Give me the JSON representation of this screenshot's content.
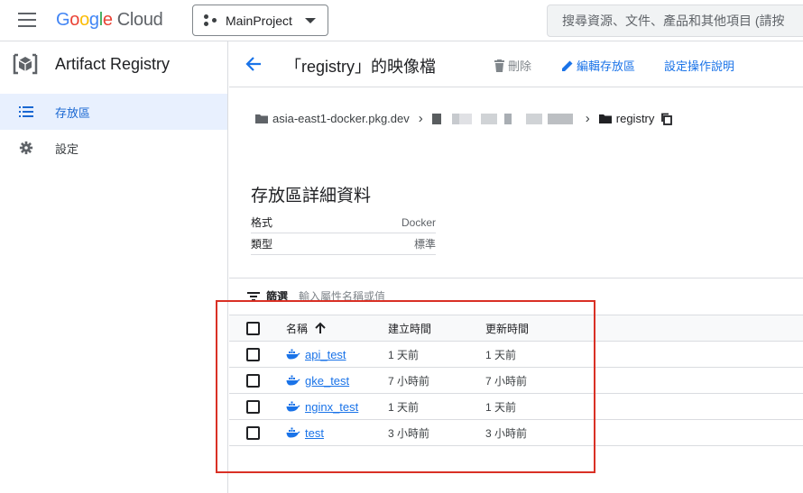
{
  "topbar": {
    "logo_letters": [
      "G",
      "o",
      "o",
      "g",
      "l",
      "e"
    ],
    "logo_cloud": "Cloud",
    "project_name": "MainProject",
    "search_placeholder": "搜尋資源、文件、產品和其他項目 (請按"
  },
  "sidebar": {
    "product_title": "Artifact Registry",
    "items": [
      {
        "label": "存放區",
        "icon": "list-icon",
        "active": true
      },
      {
        "label": "設定",
        "icon": "gear-icon",
        "active": false
      }
    ]
  },
  "header": {
    "title": "「registry」的映像檔",
    "delete_label": "刪除",
    "edit_label": "編輯存放區",
    "help_label": "設定操作說明"
  },
  "breadcrumb": {
    "host": "asia-east1-docker.pkg.dev",
    "current": "registry"
  },
  "details": {
    "title": "存放區詳細資料",
    "rows": [
      {
        "key": "格式",
        "value": "Docker"
      },
      {
        "key": "類型",
        "value": "標準"
      }
    ]
  },
  "filter": {
    "label": "篩選",
    "placeholder": "輸入屬性名稱或值"
  },
  "table": {
    "headers": {
      "name": "名稱",
      "created": "建立時間",
      "updated": "更新時間"
    },
    "rows": [
      {
        "name": "api_test",
        "created": "1 天前",
        "updated": "1 天前"
      },
      {
        "name": "gke_test",
        "created": "7 小時前",
        "updated": "7 小時前"
      },
      {
        "name": "nginx_test",
        "created": "1 天前",
        "updated": "1 天前"
      },
      {
        "name": "test",
        "created": "3 小時前",
        "updated": "3 小時前"
      }
    ]
  },
  "colors": {
    "accent": "#1a73e8",
    "highlight_box": "#d93025",
    "nav_active_bg": "#e8f0fe"
  }
}
